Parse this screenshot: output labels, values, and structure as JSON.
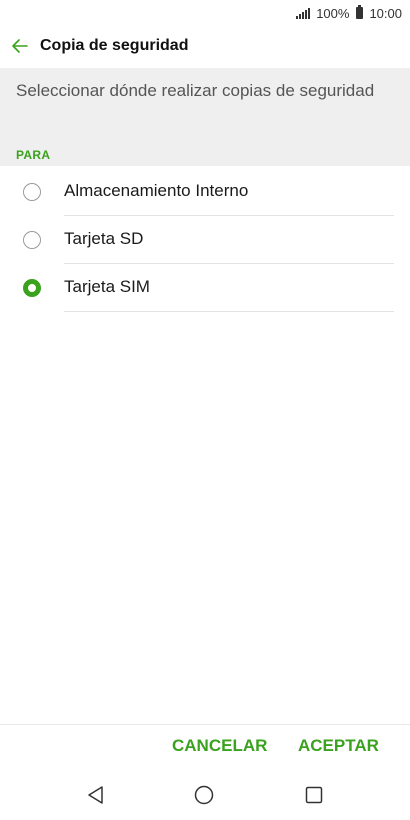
{
  "status_bar": {
    "battery_text": "100%",
    "time": "10:00",
    "icons": [
      "signal-icon",
      "battery-icon"
    ]
  },
  "app_bar": {
    "title": "Copia de seguridad",
    "back_icon": "arrow-left-icon"
  },
  "header": {
    "description": "Seleccionar dónde realizar copias de seguridad",
    "section_label": "PARA"
  },
  "options": [
    {
      "label": "Almacenamiento Interno",
      "selected": false
    },
    {
      "label": "Tarjeta SD",
      "selected": false
    },
    {
      "label": "Tarjeta SIM",
      "selected": true
    }
  ],
  "actions": {
    "cancel_label": "CANCELAR",
    "accept_label": "ACEPTAR"
  },
  "nav_bar": {
    "icons": [
      "nav-back-icon",
      "nav-home-icon",
      "nav-recent-apps-icon"
    ]
  },
  "colors": {
    "accent": "#3aa21e",
    "header_background": "#efefef",
    "radio_unselected": "#9a9a9a"
  }
}
